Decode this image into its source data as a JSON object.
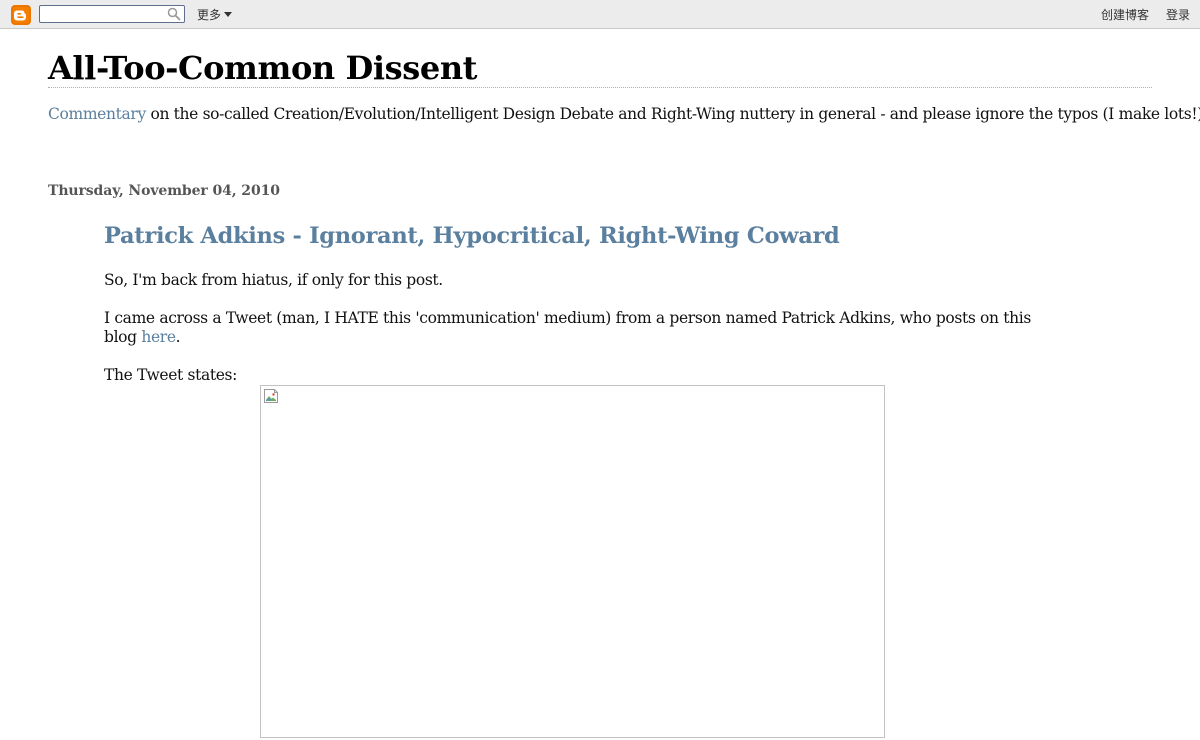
{
  "navbar": {
    "logo_icon": "blogger-logo-icon",
    "search_value": "",
    "search_icon": "search-icon",
    "more_label": "更多",
    "create_blog_label": "创建博客",
    "login_label": "登录"
  },
  "header": {
    "title": "All-Too-Common Dissent",
    "description_link": "Commentary",
    "description_rest": " on the so-called Creation/Evolution/Intelligent Design Debate and Right-Wing nuttery in general - and please ignore the typos (I make lots!)"
  },
  "post": {
    "date": "Thursday, November 04, 2010",
    "title": "Patrick Adkins - Ignorant, Hypocritical, Right-Wing Coward",
    "paragraph1": "So, I'm back from hiatus, if only for this post.",
    "paragraph2_text": "I came across a Tweet (man, I HATE this 'communication' medium) from a person named Patrick Adkins, who posts on this blog ",
    "paragraph2_link": "here",
    "paragraph2_end": ".",
    "paragraph3": "The Tweet states:",
    "image_icon": "broken-image-icon"
  },
  "colors": {
    "link": "#5b7f9e",
    "blogger_orange": "#f57d00",
    "navbar_bg": "#ececec"
  }
}
